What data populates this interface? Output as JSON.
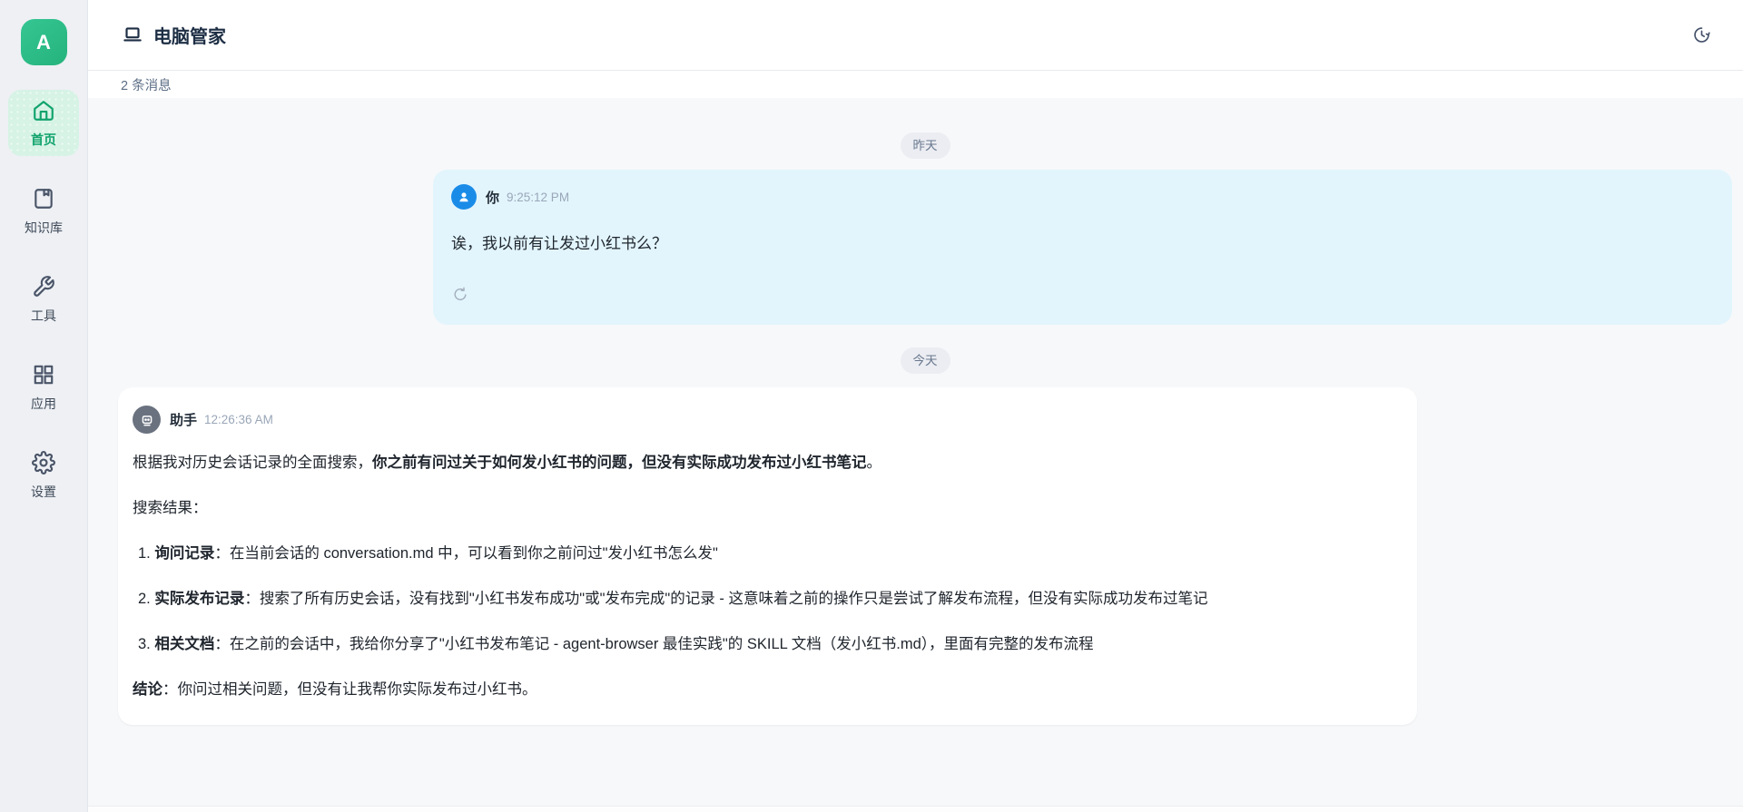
{
  "colors": {
    "accent_green": "#34c693",
    "active_green": "#11a36c",
    "avatar_blue": "#1a8ce8",
    "user_bubble": "#e2f5fd"
  },
  "sidebar": {
    "avatar_letter": "A",
    "items": [
      {
        "label": "首页",
        "icon": "home-icon",
        "active": true
      },
      {
        "label": "知识库",
        "icon": "book-icon",
        "active": false
      },
      {
        "label": "工具",
        "icon": "wrench-icon",
        "active": false
      },
      {
        "label": "应用",
        "icon": "grid-icon",
        "active": false
      },
      {
        "label": "设置",
        "icon": "gear-icon",
        "active": false
      }
    ]
  },
  "header": {
    "title": "电脑管家",
    "title_icon": "laptop-icon",
    "history_icon": "clock-history-icon",
    "message_count": "2 条消息"
  },
  "chat": {
    "date_separators": [
      "昨天",
      "今天"
    ],
    "user_message": {
      "sender": "你",
      "time": "9:25:12 PM",
      "text": "诶，我以前有让发过小红书么？",
      "action_icon": "refresh-icon"
    },
    "assistant_message": {
      "sender": "助手",
      "time": "12:26:36 AM",
      "blocks": [
        {
          "type": "p",
          "runs": [
            {
              "t": "根据我对历史会话记录的全面搜索，"
            },
            {
              "t": "你之前有问过关于如何发小红书的问题，但没有实际成功发布过小红书笔记",
              "b": true
            },
            {
              "t": "。"
            }
          ]
        },
        {
          "type": "p",
          "runs": [
            {
              "t": "搜索结果："
            }
          ]
        },
        {
          "type": "li",
          "num": "1.",
          "runs": [
            {
              "t": "询问记录",
              "b": true
            },
            {
              "t": "：在当前会话的 conversation.md 中，可以看到你之前问过\"发小红书怎么发\""
            }
          ]
        },
        {
          "type": "li",
          "num": "2.",
          "runs": [
            {
              "t": "实际发布记录",
              "b": true
            },
            {
              "t": "：搜索了所有历史会话，没有找到\"小红书发布成功\"或\"发布完成\"的记录 - 这意味着之前的操作只是尝试了解发布流程，但没有实际成功发布过笔记"
            }
          ]
        },
        {
          "type": "li",
          "num": "3.",
          "runs": [
            {
              "t": "相关文档",
              "b": true
            },
            {
              "t": "：在之前的会话中，我给你分享了\"小红书发布笔记 - agent-browser 最佳实践\"的 SKILL 文档（发小红书.md），里面有完整的发布流程"
            }
          ]
        },
        {
          "type": "p",
          "runs": [
            {
              "t": "结论",
              "b": true
            },
            {
              "t": "：你问过相关问题，但没有让我帮你实际发布过小红书。"
            }
          ]
        }
      ]
    }
  }
}
